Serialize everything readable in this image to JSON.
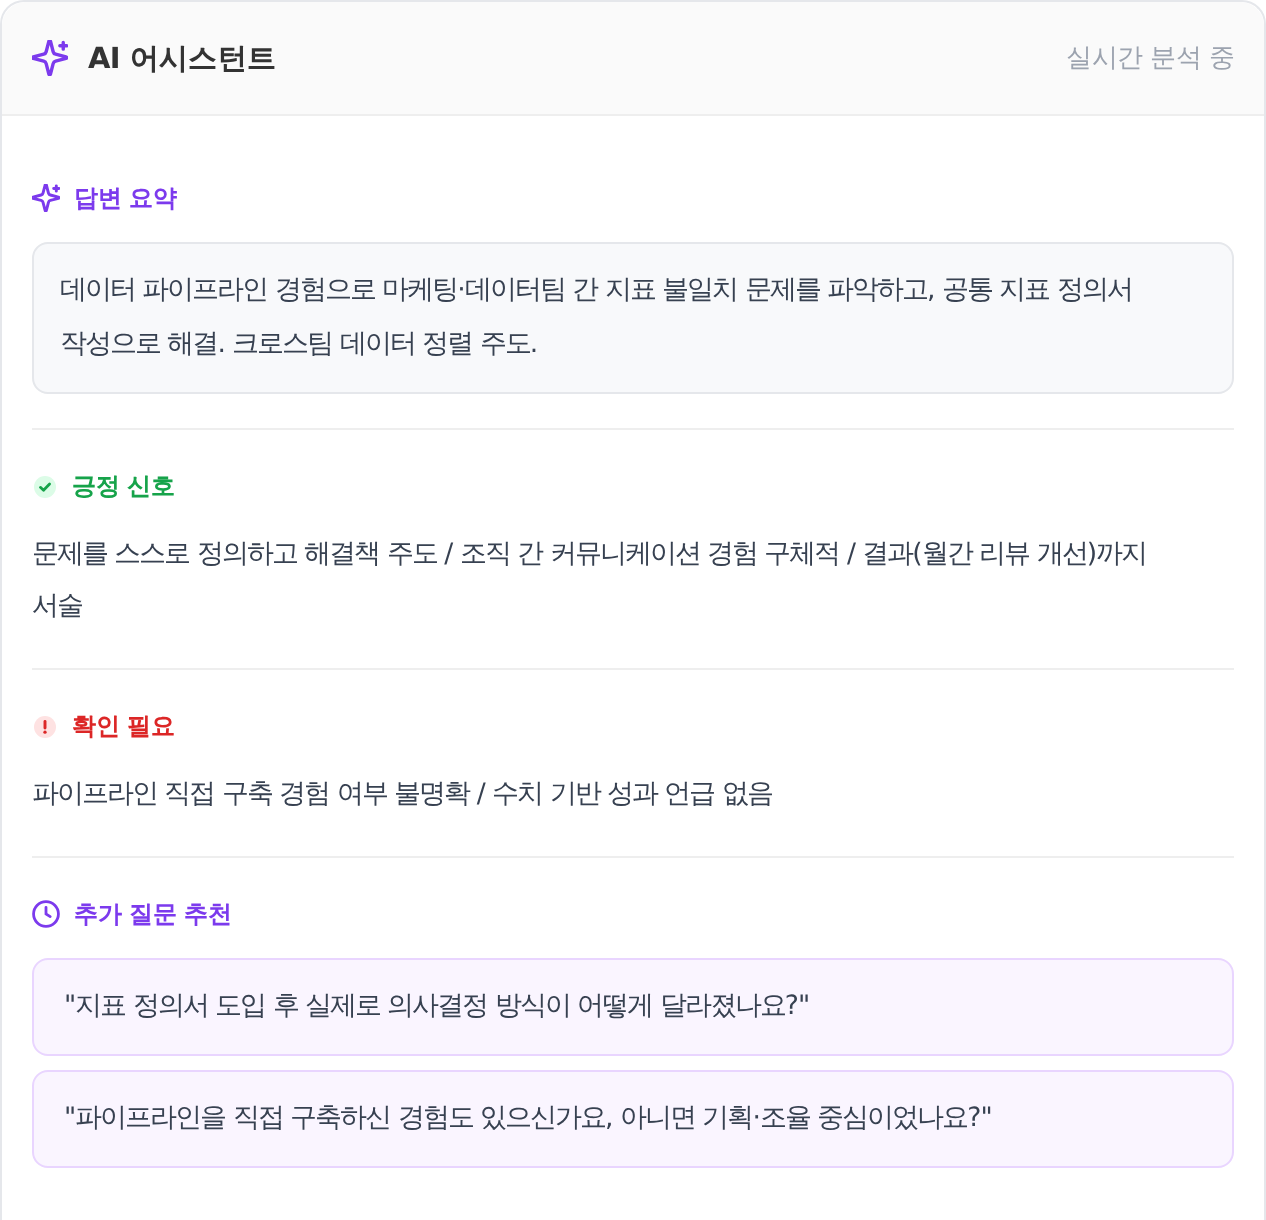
{
  "header": {
    "title": "AI 어시스턴트",
    "status": "실시간 분석 중"
  },
  "sections": [
    {
      "kind": "summary",
      "title": "답변 요약",
      "text": "데이터 파이프라인 경험으로 마케팅·데이터팀 간 지표 불일치 문제를 파악하고, 공통 지표 정의서 작성으로 해결. 크로스팀 데이터 정렬 주도."
    },
    {
      "kind": "positive",
      "title": "긍정 신호",
      "text": "문제를 스스로 정의하고 해결책 주도 / 조직 간 커뮤니케이션 경험 구체적 / 결과(월간 리뷰 개선)까지 서술"
    },
    {
      "kind": "caution",
      "title": "확인 필요",
      "text": "파이프라인 직접 구축 경험 여부 불명확 / 수치 기반 성과 언급 없음"
    },
    {
      "kind": "questions",
      "title": "추가 질문 추천",
      "questions": [
        "\"지표 정의서 도입 후 실제로 의사결정 방식이 어떻게 달라졌나요?\"",
        "\"파이프라인을 직접 구축하신 경험도 있으신가요, 아니면 기획·조율 중심이었나요?\""
      ]
    }
  ]
}
